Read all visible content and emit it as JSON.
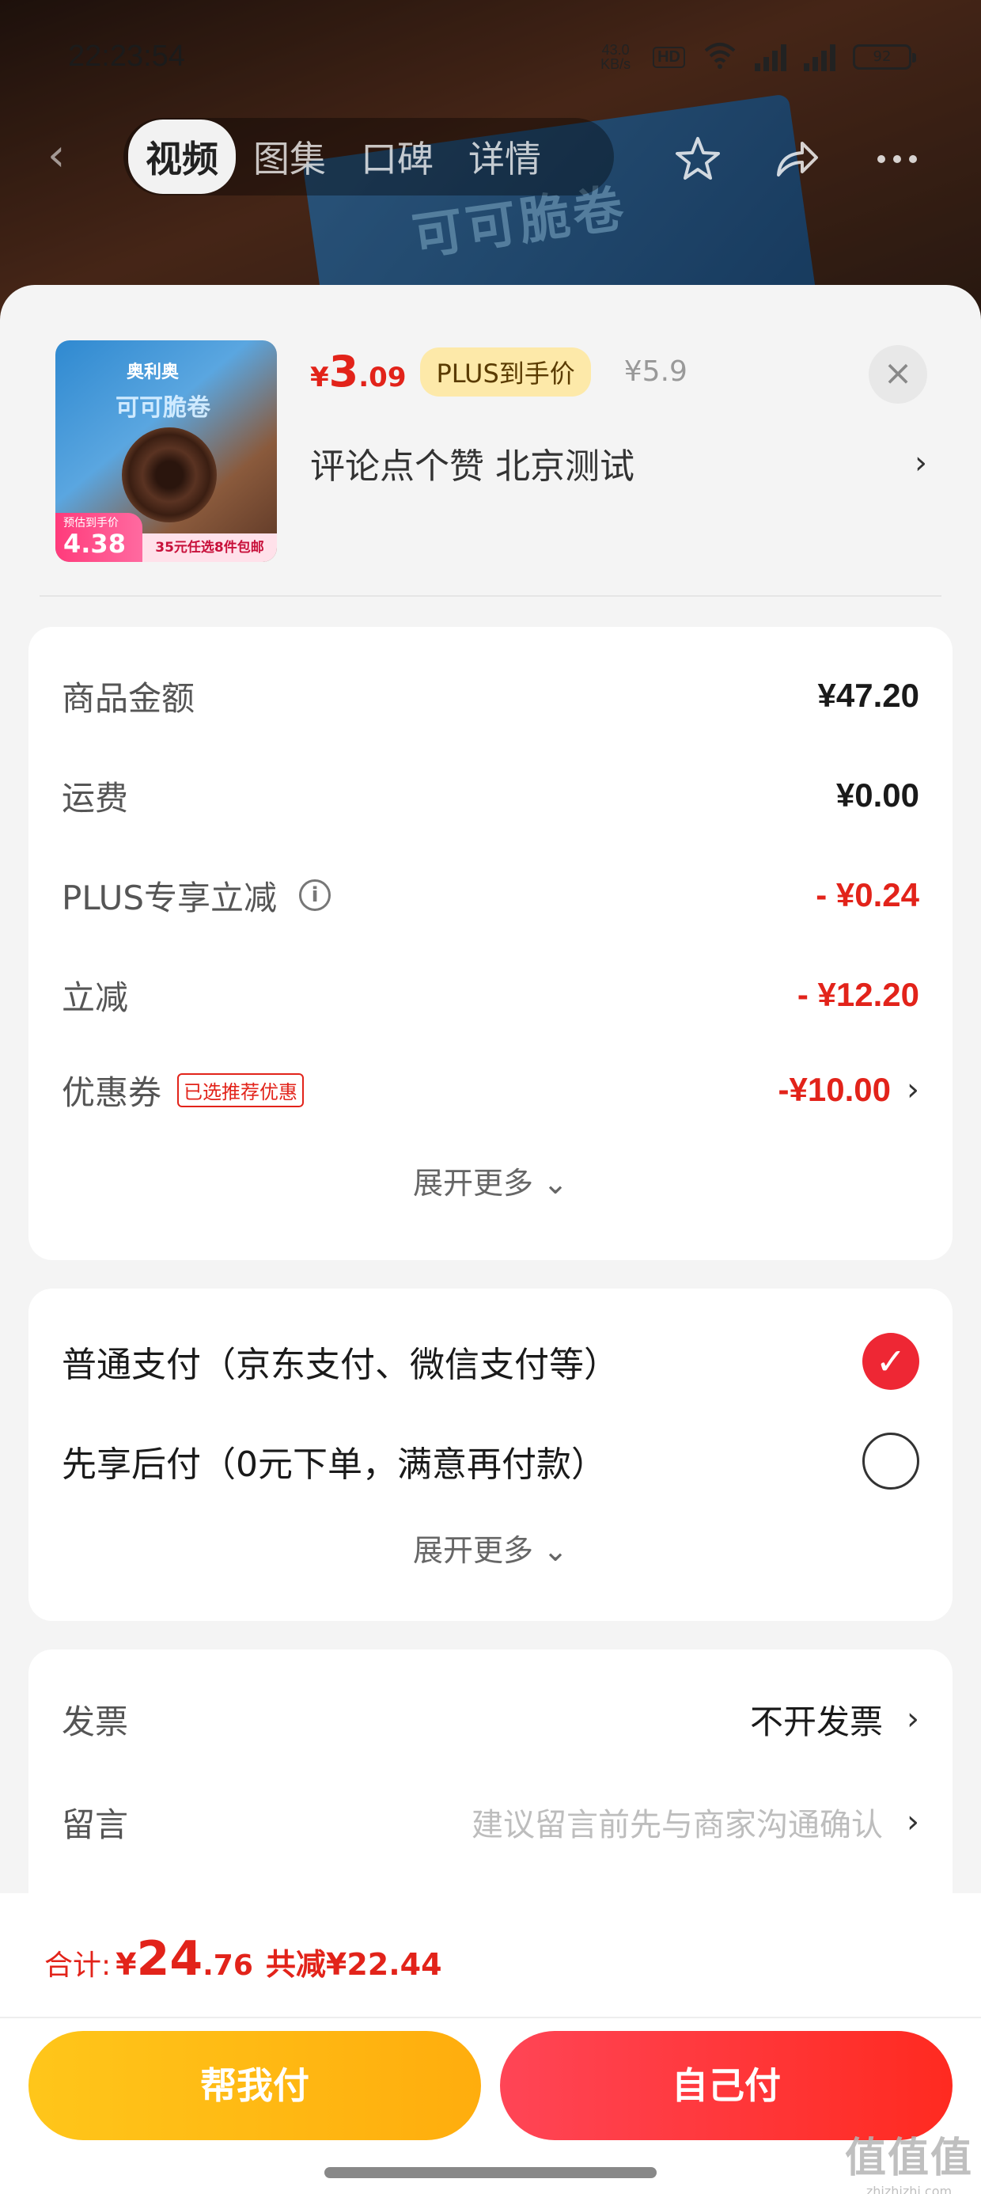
{
  "status_bar": {
    "time": "22:23:54",
    "speed": "43.0 KB/s",
    "hd": "HD",
    "battery": "92"
  },
  "nav": {
    "back": "‹",
    "tabs": [
      {
        "label": "视频",
        "active": true
      },
      {
        "label": "图集",
        "active": false
      },
      {
        "label": "口碑",
        "active": false
      },
      {
        "label": "详情",
        "active": false
      }
    ]
  },
  "background": {
    "brand_text": "奥利奥",
    "product_text": "可可脆卷"
  },
  "product": {
    "thumb_brand": "奥利奥",
    "thumb_name": "可可脆卷",
    "thumb_price_label": "预估到手价",
    "thumb_price": "4.38",
    "thumb_promo": "35元任选8件包邮",
    "price_yen": "¥",
    "price_int": "3",
    "price_dec": ".09",
    "plus_badge": "PLUS到手价",
    "original_price": "¥5.9",
    "close": "×",
    "spec": "评论点个赞  北京测试",
    "spec_chevron": "›"
  },
  "summary": {
    "rows": [
      {
        "label": "商品金额",
        "value": "¥47.20",
        "red": false
      },
      {
        "label": "运费",
        "value": "¥0.00",
        "red": false
      },
      {
        "label": "PLUS专享立减",
        "value": "- ¥0.24",
        "red": true,
        "info": "i"
      },
      {
        "label": "立减",
        "value": "- ¥12.20",
        "red": true
      },
      {
        "label": "优惠券",
        "value": "-¥10.00",
        "red": true,
        "tag": "已选推荐优惠",
        "chevron": "›"
      }
    ],
    "expand": "展开更多 ⌄"
  },
  "payment": {
    "options": [
      {
        "label": "普通支付（京东支付、微信支付等）",
        "selected": true
      },
      {
        "label": "先享后付（0元下单，满意再付款）",
        "selected": false
      }
    ],
    "check": "✓",
    "expand": "展开更多 ⌄"
  },
  "extras": {
    "invoice_label": "发票",
    "invoice_value": "不开发票",
    "message_label": "留言",
    "message_placeholder": "建议留言前先与商家沟通确认",
    "chevron": "›"
  },
  "footer": {
    "total_label": "合计:",
    "total_yen": "¥",
    "total_int": "24",
    "total_dec": ".76",
    "saving": "共减¥22.44",
    "help_pay": "帮我付",
    "self_pay": "自己付"
  },
  "watermark": {
    "big": "值值值",
    "small": "zhizhizhi.com"
  },
  "colors": {
    "accent_red": "#e2231a",
    "pay_yellow": "#ffb812",
    "pay_red": "#ff3344",
    "plus_gold": "#fde9a9"
  }
}
